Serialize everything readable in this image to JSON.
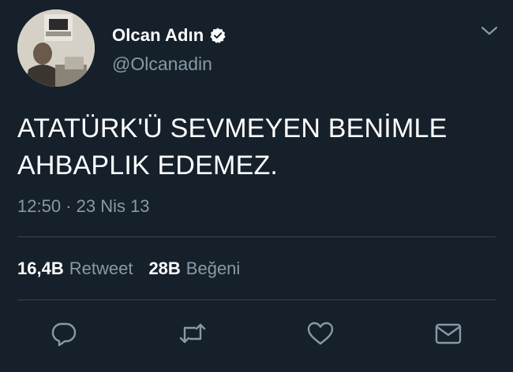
{
  "user": {
    "display_name": "Olcan Adın",
    "handle": "@Olcanadin",
    "verified_icon": "verified-badge-icon"
  },
  "tweet": {
    "lines": [
      "ATATÜRK'Ü SEVMEYEN BENİMLE",
      "AHBAPLIK EDEMEZ."
    ],
    "timestamp": "12:50 · 23 Nis 13"
  },
  "stats": {
    "retweets_count": "16,4B",
    "retweets_label": "Retweet",
    "likes_count": "28B",
    "likes_label": "Beğeni"
  },
  "actions": [
    "reply-icon",
    "retweet-icon",
    "like-icon",
    "direct-message-icon"
  ],
  "colors": {
    "background": "#15202b",
    "text_primary": "#ffffff",
    "text_secondary": "#8899a6",
    "divider": "#38444d"
  }
}
